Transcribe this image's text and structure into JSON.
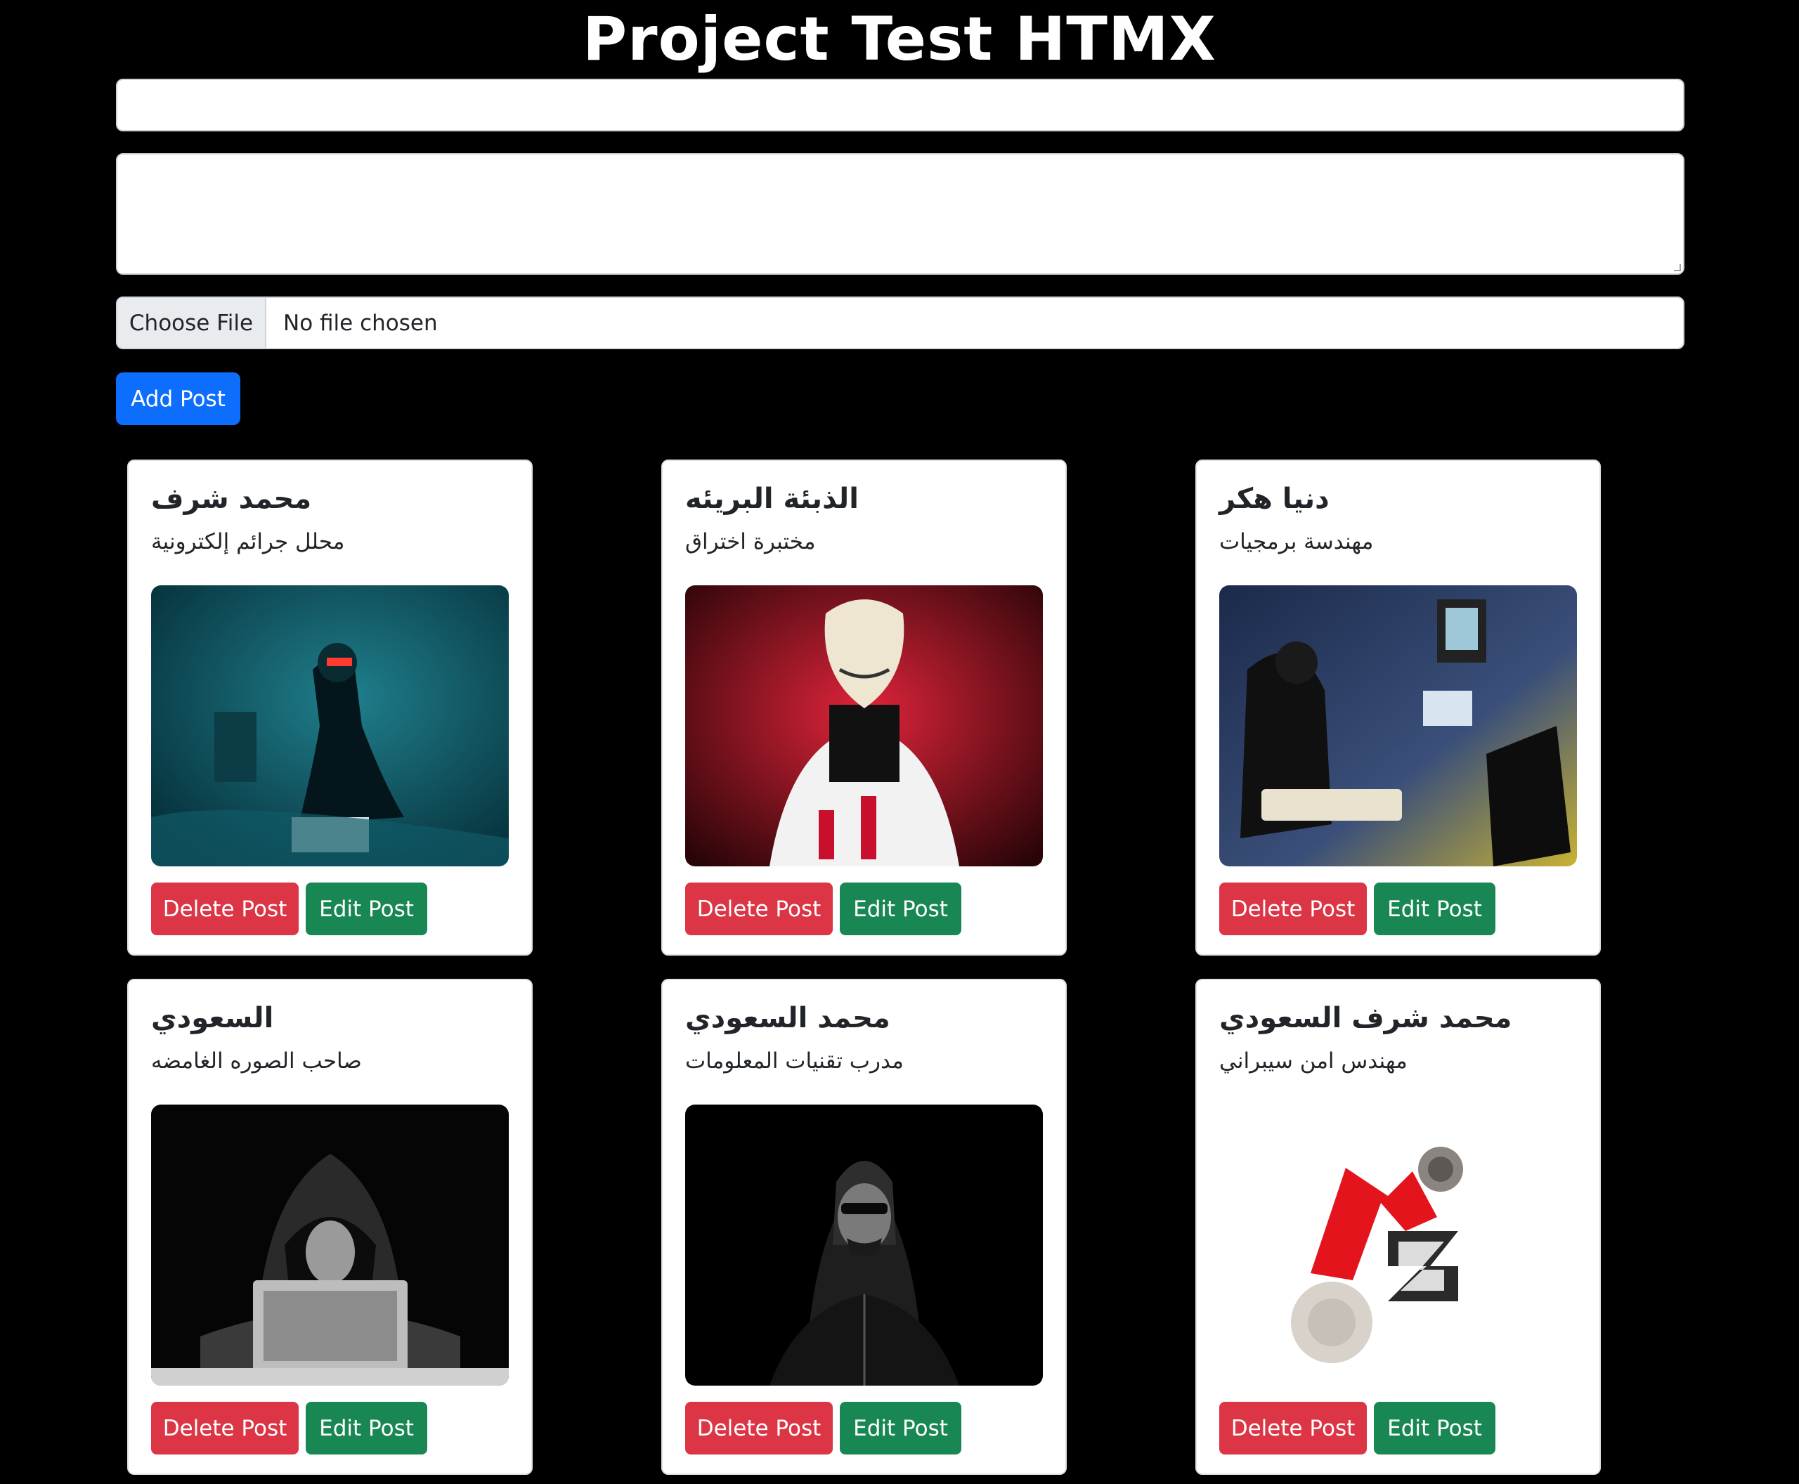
{
  "header": {
    "title": "Project Test HTMX"
  },
  "form": {
    "title_value": "",
    "body_value": "",
    "file_button_label": "Choose File",
    "file_status": "No file chosen",
    "submit_label": "Add Post"
  },
  "posts": [
    {
      "title": "محمد شرف",
      "subtitle": "محلل جرائم إلكترونية",
      "image": "hacker-teal-room",
      "delete_label": "Delete Post",
      "edit_label": "Edit Post"
    },
    {
      "title": "الذبئة البريئه",
      "subtitle": "مختبرة اختراق",
      "image": "mask-red-smoke",
      "delete_label": "Delete Post",
      "edit_label": "Edit Post"
    },
    {
      "title": "دنيا هكر",
      "subtitle": "مهندسة برمجيات",
      "image": "woman-keyboard-screens",
      "delete_label": "Delete Post",
      "edit_label": "Edit Post"
    },
    {
      "title": "السعودي",
      "subtitle": "صاحب الصوره الغامضه",
      "image": "hooded-laptop-bw",
      "delete_label": "Delete Post",
      "edit_label": "Edit Post"
    },
    {
      "title": "محمد السعودي",
      "subtitle": "مدرب تقنيات المعلومات",
      "image": "hooded-man-dark",
      "delete_label": "Delete Post",
      "edit_label": "Edit Post"
    },
    {
      "title": "محمد شرف السعودي",
      "subtitle": "مهندس امن سيبراني",
      "image": "ms-logo",
      "delete_label": "Delete Post",
      "edit_label": "Edit Post"
    }
  ],
  "colors": {
    "background": "#000000",
    "primary": "#0d6efd",
    "danger": "#dc3545",
    "success": "#198754"
  }
}
